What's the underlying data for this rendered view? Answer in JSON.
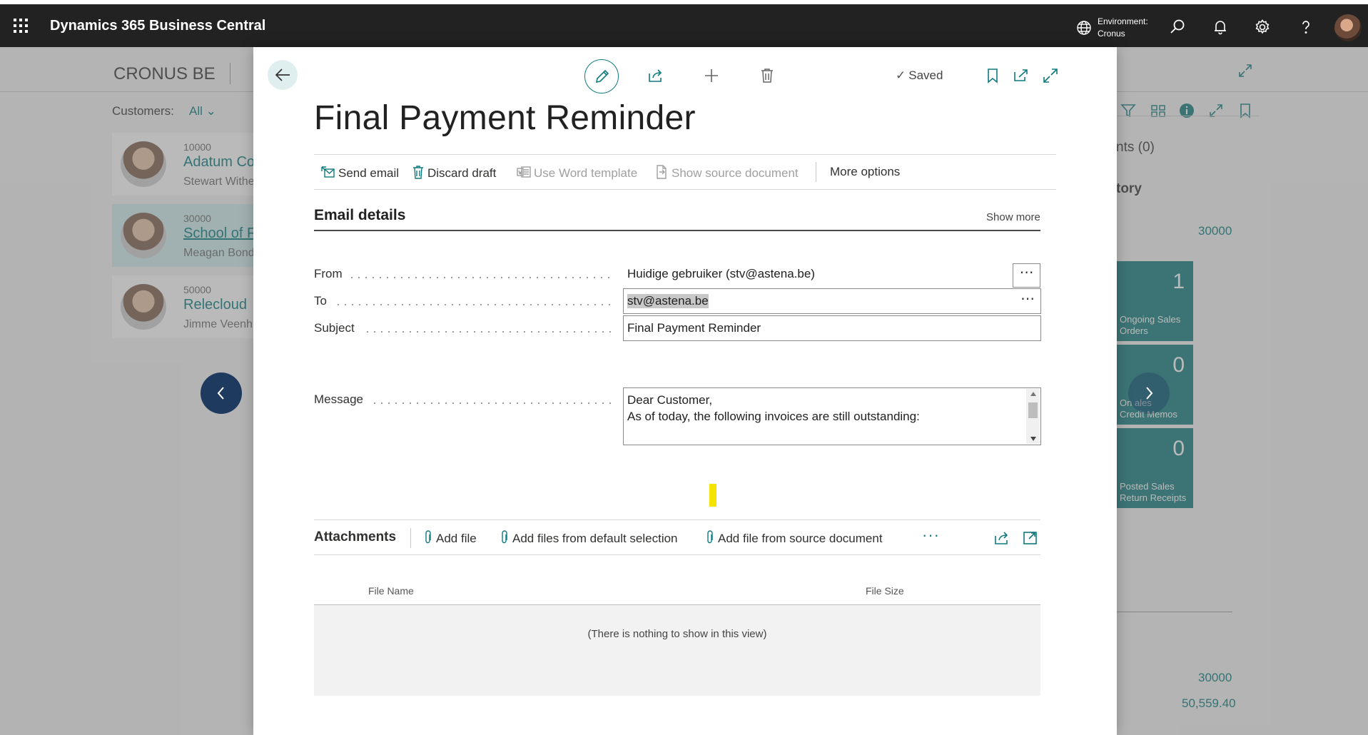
{
  "topbar": {
    "app_title": "Dynamics 365 Business Central",
    "environment_label": "Environment:",
    "environment_value": "Cronus",
    "icons": [
      "app-launcher-icon",
      "globe-icon",
      "search-icon",
      "bell-icon",
      "gear-icon",
      "help-icon",
      "avatar"
    ]
  },
  "background": {
    "company": "CRONUS BE",
    "filter_label": "Customers:",
    "filter_value": "All",
    "customers": [
      {
        "no": "10000",
        "name": "Adatum Co",
        "contact": "Stewart Withe"
      },
      {
        "no": "30000",
        "name": "School of F",
        "contact": "Meagan Bond"
      },
      {
        "no": "50000",
        "name": "Relecloud",
        "contact": "Jimme Veenh"
      }
    ],
    "right_panel": {
      "attachments": "nts (0)",
      "history": "tory",
      "customer_no": "30000",
      "tiles": [
        {
          "value": "1",
          "caption_1": "Ongoing Sales",
          "caption_2": "Orders"
        },
        {
          "value": "0",
          "caption_1": "On      ales",
          "caption_2": "Credit Memos"
        },
        {
          "value": "0",
          "caption_1": "Posted Sales",
          "caption_2": "Return Receipts"
        }
      ],
      "bottom_no": "30000",
      "bottom_amount": "50,559.40"
    }
  },
  "dialog": {
    "status": "Saved",
    "title": "Final Payment Reminder",
    "actions": {
      "send_email": "Send email",
      "discard_draft": "Discard draft",
      "use_word_template": "Use Word template",
      "show_source_document": "Show source document",
      "more_options": "More options"
    },
    "email_details": {
      "heading": "Email details",
      "show_more": "Show more",
      "from_label": "From",
      "from_value": "Huidige gebruiker (stv@astena.be)",
      "to_label": "To",
      "to_value": "stv@astena.be",
      "subject_label": "Subject",
      "subject_value": "Final Payment Reminder",
      "message_label": "Message",
      "message_line_1": "Dear Customer,",
      "message_line_2": "As of today, the following invoices are still outstanding:"
    },
    "attachments": {
      "heading": "Attachments",
      "add_file": "Add file",
      "add_default": "Add files from default selection",
      "add_source": "Add file from source document",
      "more": "···",
      "col_file_name": "File Name",
      "col_file_size": "File Size",
      "empty": "(There is nothing to show in this view)"
    }
  },
  "colors": {
    "accent": "#0f7a7e",
    "topbar": "#222222",
    "highlight": "#f5e300"
  }
}
